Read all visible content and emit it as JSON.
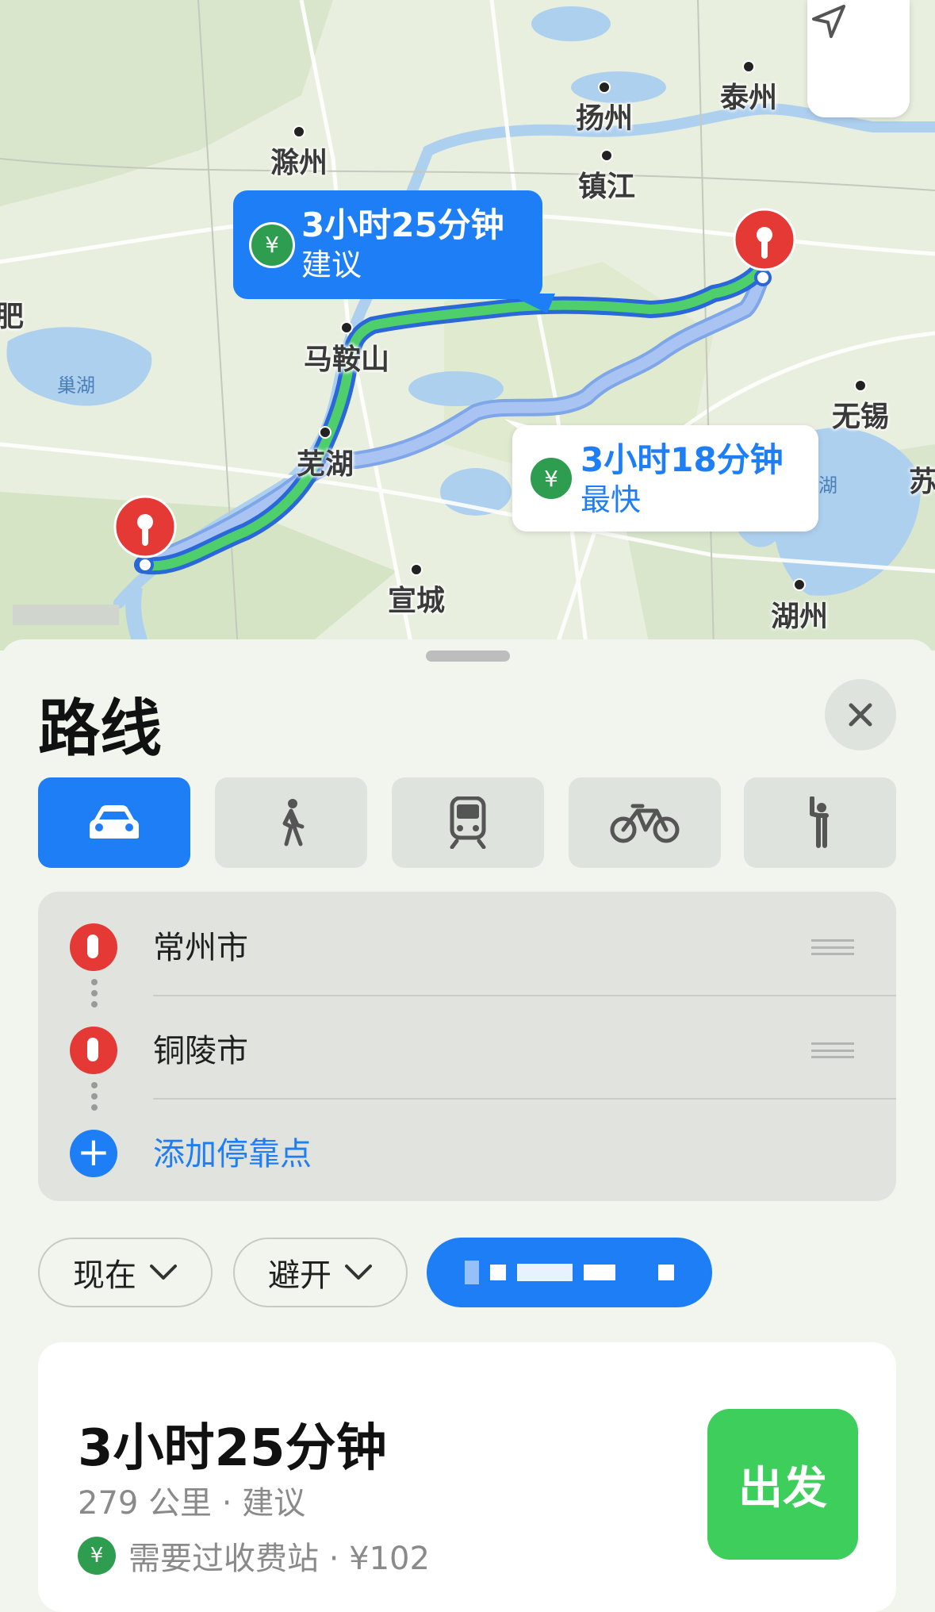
{
  "map": {
    "cities": [
      "泰州",
      "扬州",
      "滁州",
      "镇江",
      "马鞍山",
      "无锡",
      "芜湖",
      "宣城",
      "湖州",
      "苏",
      "肥"
    ],
    "lake_label": "巢湖",
    "lake_label_2": "湖",
    "route_callouts": {
      "suggested": {
        "duration": "3小时25分钟",
        "tag": "建议"
      },
      "fastest": {
        "duration": "3小时18分钟",
        "tag": "最快"
      }
    }
  },
  "sheet": {
    "title": "路线",
    "transport_modes": [
      {
        "name": "drive",
        "icon": "car-icon",
        "active": true
      },
      {
        "name": "walk",
        "icon": "walking-icon",
        "active": false
      },
      {
        "name": "transit",
        "icon": "train-icon",
        "active": false
      },
      {
        "name": "bike",
        "icon": "bicycle-icon",
        "active": false
      },
      {
        "name": "rideshare",
        "icon": "hail-icon",
        "active": false
      }
    ],
    "stops": [
      {
        "label": "常州市"
      },
      {
        "label": "铜陵市"
      }
    ],
    "add_stop_label": "添加停靠点",
    "options": {
      "time_label": "现在",
      "avoid_label": "避开"
    },
    "route": {
      "duration": "3小时25分钟",
      "distance_label": "279 公里 · 建议",
      "toll_label": "需要过收费站 · ¥102",
      "go_label": "出发"
    }
  },
  "colors": {
    "accent_blue": "#1d7ef5",
    "route_green": "#4fcf6c",
    "alt_route": "#9fbef0",
    "pin_red": "#e53935",
    "go_green": "#3dce5b"
  }
}
